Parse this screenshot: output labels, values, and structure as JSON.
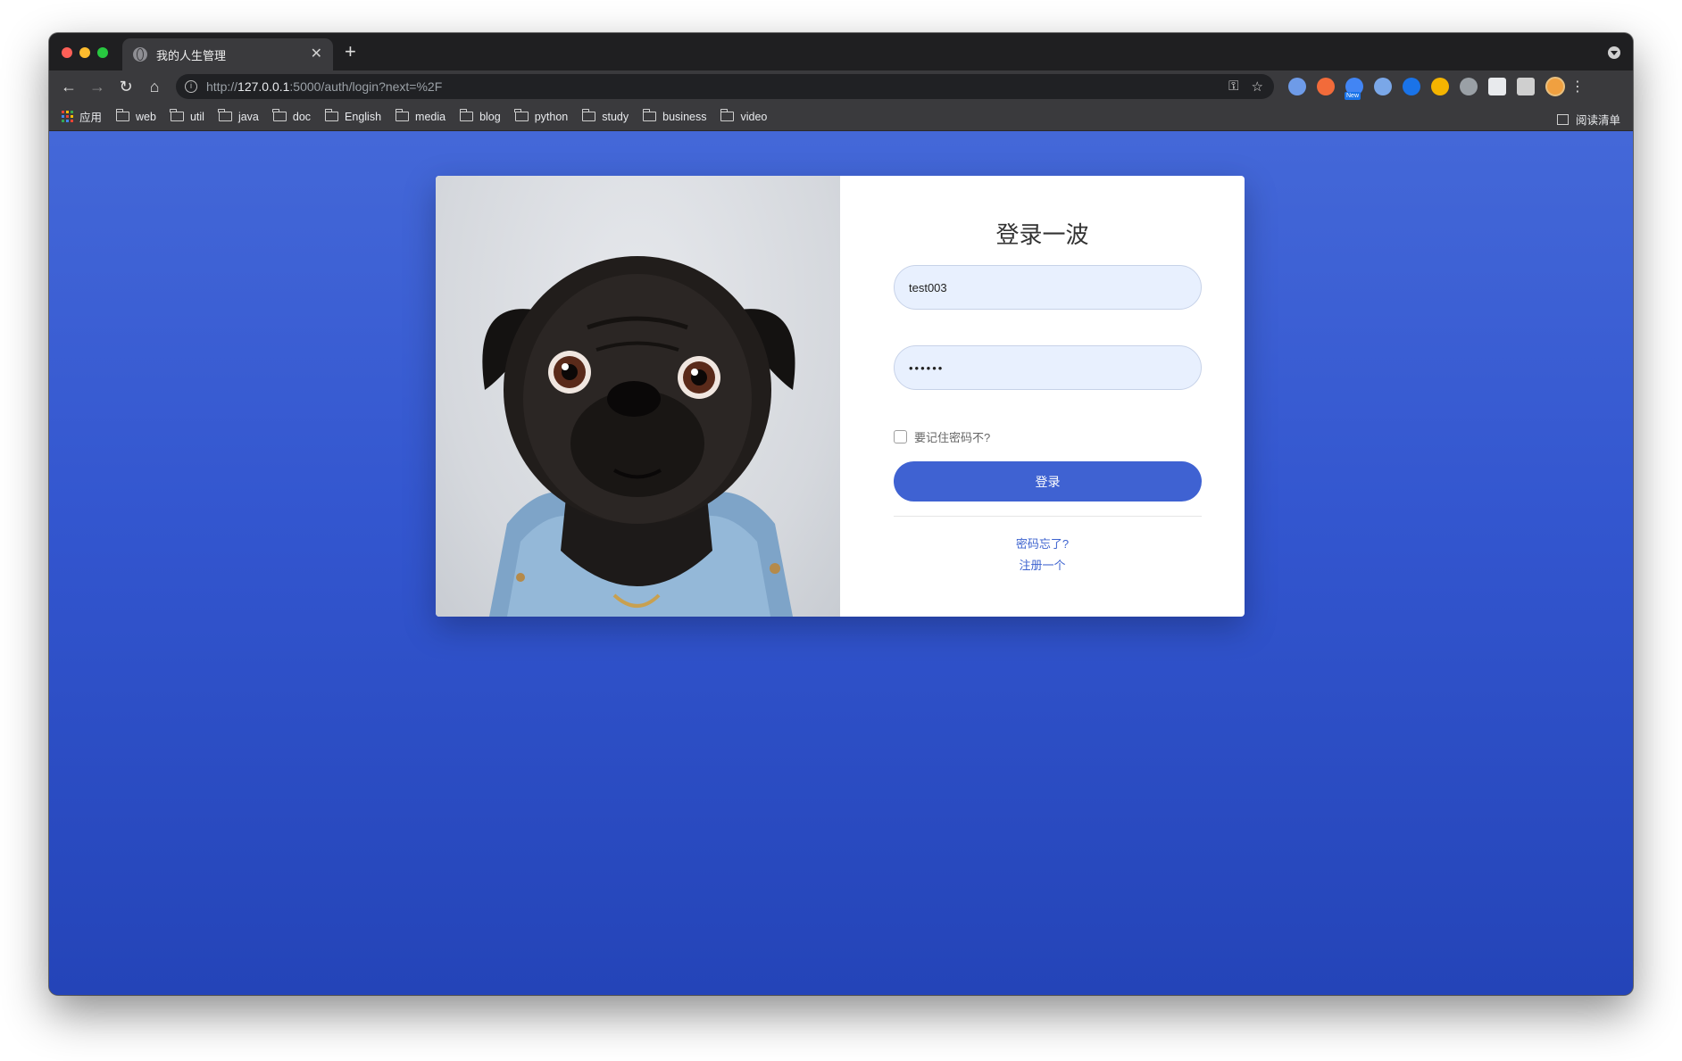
{
  "tab": {
    "title": "我的人生管理",
    "close": "✕",
    "new_tab": "+"
  },
  "address": {
    "scheme": "http://",
    "host": "127.0.0.1",
    "rest": ":5000/auth/login?next=%2F"
  },
  "extensions": [
    {
      "name": "extension-1",
      "color": "#6e9be8"
    },
    {
      "name": "extension-2",
      "color": "#f26b3a"
    },
    {
      "name": "extension-3",
      "color": "#4285f4",
      "badge": "New"
    },
    {
      "name": "extension-4",
      "color": "#7aa7e8"
    },
    {
      "name": "extension-5",
      "color": "#1a73e8"
    },
    {
      "name": "extension-6",
      "color": "#f4b400"
    },
    {
      "name": "extension-7",
      "color": "#9aa0a6"
    },
    {
      "name": "extension-8",
      "color": "#e8eaed"
    },
    {
      "name": "extension-9",
      "color": "#cfcfcf"
    }
  ],
  "bookmarks": {
    "apps_label": "应用",
    "folders": [
      "web",
      "util",
      "java",
      "doc",
      "English",
      "media",
      "blog",
      "python",
      "study",
      "business",
      "video"
    ],
    "reading_list": "阅读清单"
  },
  "login": {
    "title": "登录一波",
    "username_value": "test003",
    "password_value": "••••••",
    "remember_label": "要记住密码不?",
    "submit_label": "登录",
    "forgot_link": "密码忘了?",
    "register_link": "注册一个"
  },
  "colors": {
    "page_gradient_top": "#4468d8",
    "page_gradient_bottom": "#2444b8",
    "accent": "#3f62d2",
    "link": "#3d63cf",
    "input_bg": "#e8f0fe"
  }
}
